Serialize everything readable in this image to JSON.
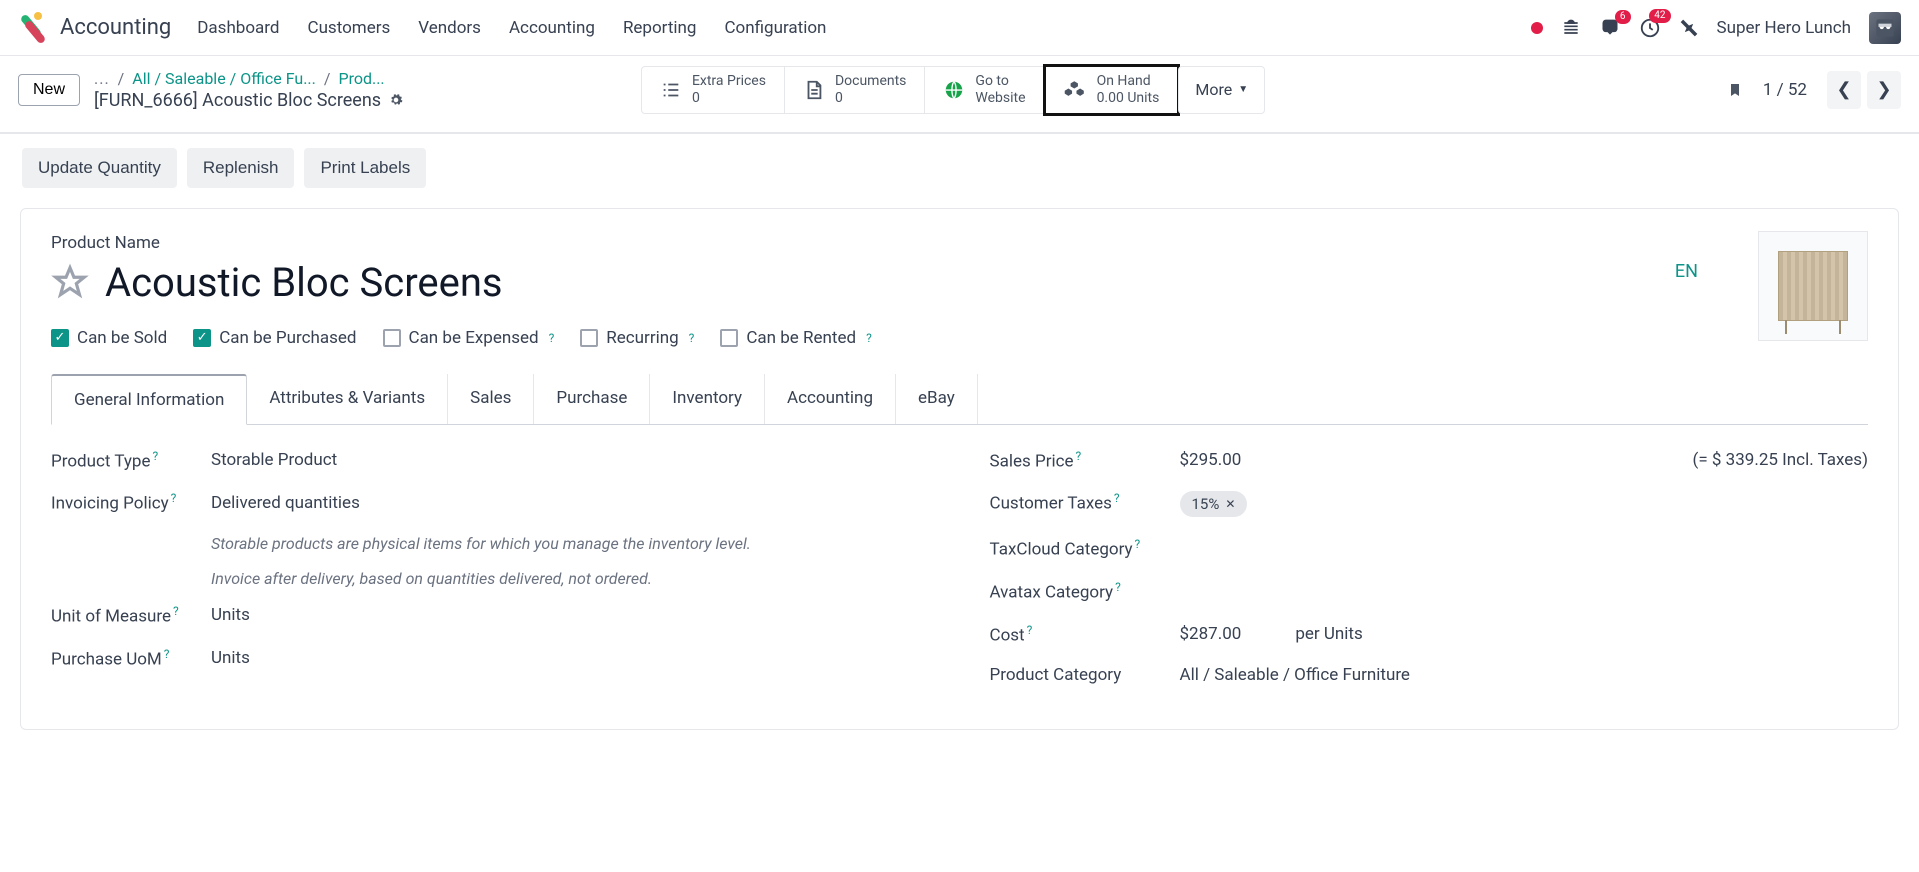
{
  "header": {
    "app_title": "Accounting",
    "menu": [
      "Dashboard",
      "Customers",
      "Vendors",
      "Accounting",
      "Reporting",
      "Configuration"
    ],
    "badge_chat": "6",
    "badge_activity": "42",
    "user_name": "Super Hero Lunch"
  },
  "breadcrumb": {
    "ellipsis": "...",
    "path1": "All / Saleable / Office Fu...",
    "path2": "Prod...",
    "record_code": "[FURN_6666] Acoustic Bloc Screens",
    "new_button": "New"
  },
  "stats": {
    "extra_prices": {
      "label": "Extra Prices",
      "value": "0"
    },
    "documents": {
      "label": "Documents",
      "value": "0"
    },
    "website": {
      "label": "Go to",
      "value": "Website"
    },
    "on_hand": {
      "label": "On Hand",
      "value": "0.00 Units"
    },
    "more": "More"
  },
  "pager": {
    "text": "1 / 52"
  },
  "actions": {
    "update_qty": "Update Quantity",
    "replenish": "Replenish",
    "print_labels": "Print Labels"
  },
  "product": {
    "name_label": "Product Name",
    "name": "Acoustic Bloc Screens",
    "lang": "EN",
    "checks": {
      "sold": "Can be Sold",
      "purchased": "Can be Purchased",
      "expensed": "Can be Expensed",
      "recurring": "Recurring",
      "rented": "Can be Rented"
    }
  },
  "tabs": [
    "General Information",
    "Attributes & Variants",
    "Sales",
    "Purchase",
    "Inventory",
    "Accounting",
    "eBay"
  ],
  "fields_left": {
    "product_type": {
      "label": "Product Type",
      "value": "Storable Product"
    },
    "invoicing_policy": {
      "label": "Invoicing Policy",
      "value": "Delivered quantities"
    },
    "hint1": "Storable products are physical items for which you manage the inventory level.",
    "hint2": "Invoice after delivery, based on quantities delivered, not ordered.",
    "uom": {
      "label": "Unit of Measure",
      "value": "Units"
    },
    "purchase_uom": {
      "label": "Purchase UoM",
      "value": "Units"
    }
  },
  "fields_right": {
    "sales_price": {
      "label": "Sales Price",
      "value": "$295.00",
      "incl": "(= $ 339.25 Incl. Taxes)"
    },
    "customer_taxes": {
      "label": "Customer Taxes",
      "value": "15%"
    },
    "taxcloud": {
      "label": "TaxCloud Category"
    },
    "avatax": {
      "label": "Avatax Category"
    },
    "cost": {
      "label": "Cost",
      "value": "$287.00",
      "per": "per Units"
    },
    "category": {
      "label": "Product Category",
      "value": "All / Saleable / Office Furniture"
    }
  }
}
